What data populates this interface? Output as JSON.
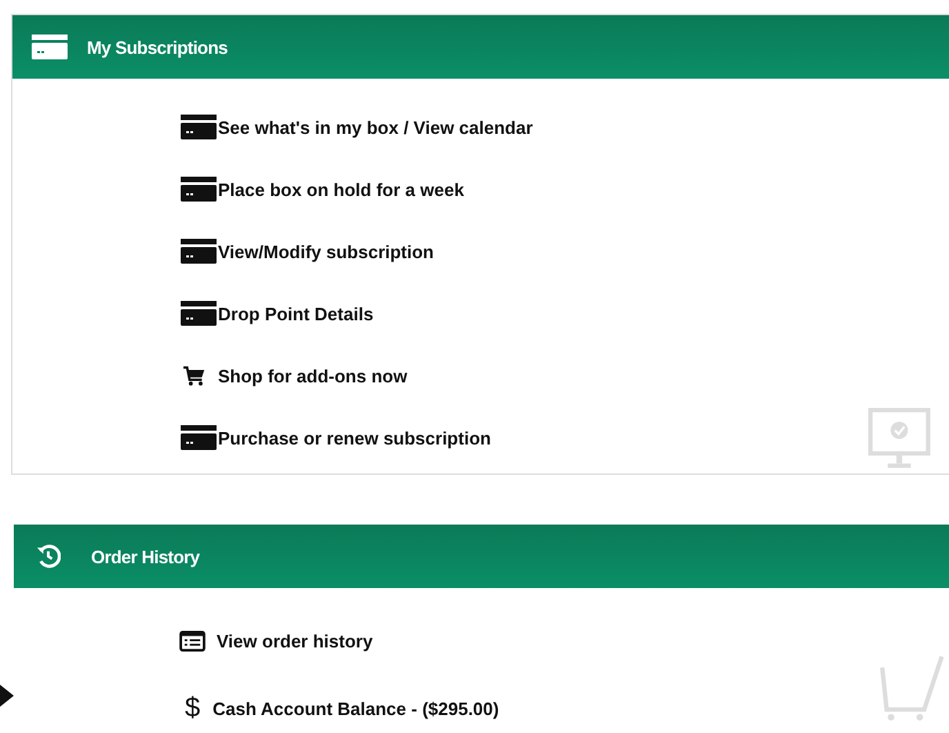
{
  "panels": [
    {
      "kind": "subscriptions",
      "title": "My Subscriptions",
      "items": [
        {
          "kind": "card",
          "label": "See what's in my box / View calendar"
        },
        {
          "kind": "card",
          "label": "Place box on hold for a week"
        },
        {
          "kind": "card",
          "label": "View/Modify subscription"
        },
        {
          "kind": "card",
          "label": "Drop Point Details"
        },
        {
          "kind": "cart",
          "label": "Shop for add-ons now"
        },
        {
          "kind": "card",
          "label": "Purchase or renew subscription"
        }
      ]
    },
    {
      "kind": "orders",
      "title": "Order History",
      "items": [
        {
          "kind": "list",
          "label": "View order history"
        },
        {
          "kind": "glyph",
          "glyph": "$",
          "label": "Cash Account Balance - ($295.00)"
        }
      ]
    }
  ]
}
